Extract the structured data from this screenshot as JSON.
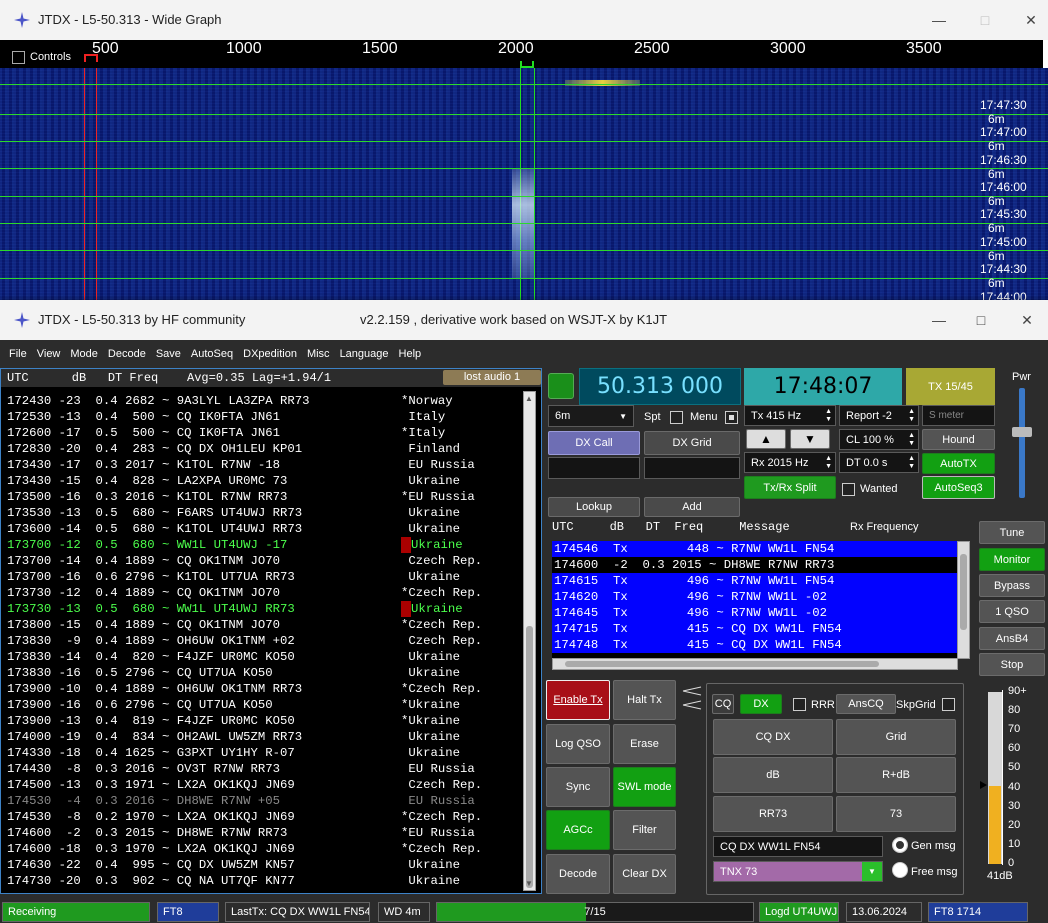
{
  "wide_graph": {
    "title": "JTDX - L5-50.313 - Wide Graph",
    "controls_label": "Controls",
    "ruler_ticks": [
      "500",
      "1000",
      "1500",
      "2000",
      "2500",
      "3000",
      "3500"
    ],
    "time_labels": [
      "17:47:30",
      "17:47:00",
      "17:46:30",
      "17:46:00",
      "17:45:30",
      "17:45:00",
      "17:44:30",
      "17:44:00"
    ],
    "band_suffix": "6m"
  },
  "main": {
    "title": "JTDX - L5-50.313  by HF community",
    "subtitle": "v2.2.159 , derivative work based on WSJT-X by K1JT",
    "menu": [
      "File",
      "View",
      "Mode",
      "Decode",
      "Save",
      "AutoSeq",
      "DXpedition",
      "Misc",
      "Language",
      "Help"
    ],
    "decode_header": "UTC      dB   DT Freq    Avg=0.35 Lag=+1.94/1",
    "lost_audio": "lost audio 1",
    "decodes": [
      {
        "msg": "172430 -23  0.4 2682 ~ 9A3LYL LA3ZPA RR73",
        "country": "*Norway",
        "color": "#ffffff",
        "mark": false
      },
      {
        "msg": "172530 -13  0.4  500 ~ CQ IK0FTA JN61",
        "country": " Italy",
        "color": "#ffffff",
        "mark": false
      },
      {
        "msg": "172600 -17  0.5  500 ~ CQ IK0FTA JN61",
        "country": "*Italy",
        "color": "#ffffff",
        "mark": false
      },
      {
        "msg": "172830 -20  0.4  283 ~ CQ DX OH1LEU KP01",
        "country": " Finland",
        "color": "#ffffff",
        "mark": false
      },
      {
        "msg": "173430 -17  0.3 2017 ~ K1TOL R7NW -18",
        "country": " EU Russia",
        "color": "#ffffff",
        "mark": false
      },
      {
        "msg": "173430 -15  0.4  828 ~ LA2XPA UR0MC 73",
        "country": " Ukraine",
        "color": "#ffffff",
        "mark": false
      },
      {
        "msg": "173500 -16  0.3 2016 ~ K1TOL R7NW RR73",
        "country": "*EU Russia",
        "color": "#ffffff",
        "mark": false
      },
      {
        "msg": "173530 -13  0.5  680 ~ F6ARS UT4UWJ RR73",
        "country": " Ukraine",
        "color": "#ffffff",
        "mark": false
      },
      {
        "msg": "173600 -14  0.5  680 ~ K1TOL UT4UWJ RR73",
        "country": " Ukraine",
        "color": "#ffffff",
        "mark": false
      },
      {
        "msg": "173700 -12  0.5  680 ~ WW1L UT4UWJ -17",
        "country": "Ukraine",
        "color": "#4cff4c",
        "mark": true
      },
      {
        "msg": "173700 -14  0.4 1889 ~ CQ OK1TNM JO70",
        "country": " Czech Rep.",
        "color": "#ffffff",
        "mark": false
      },
      {
        "msg": "173700 -16  0.6 2796 ~ K1TOL UT7UA RR73",
        "country": " Ukraine",
        "color": "#ffffff",
        "mark": false
      },
      {
        "msg": "173730 -12  0.4 1889 ~ CQ OK1TNM JO70",
        "country": "*Czech Rep.",
        "color": "#ffffff",
        "mark": false
      },
      {
        "msg": "173730 -13  0.5  680 ~ WW1L UT4UWJ RR73",
        "country": "Ukraine",
        "color": "#4cff4c",
        "mark": true
      },
      {
        "msg": "173800 -15  0.4 1889 ~ CQ OK1TNM JO70",
        "country": "*Czech Rep.",
        "color": "#ffffff",
        "mark": false
      },
      {
        "msg": "173830  -9  0.4 1889 ~ OH6UW OK1TNM +02",
        "country": " Czech Rep.",
        "color": "#ffffff",
        "mark": false
      },
      {
        "msg": "173830 -14  0.4  820 ~ F4JZF UR0MC KO50",
        "country": " Ukraine",
        "color": "#ffffff",
        "mark": false
      },
      {
        "msg": "173830 -16  0.5 2796 ~ CQ UT7UA KO50",
        "country": " Ukraine",
        "color": "#ffffff",
        "mark": false
      },
      {
        "msg": "173900 -10  0.4 1889 ~ OH6UW OK1TNM RR73",
        "country": "*Czech Rep.",
        "color": "#ffffff",
        "mark": false
      },
      {
        "msg": "173900 -16  0.6 2796 ~ CQ UT7UA KO50",
        "country": "*Ukraine",
        "color": "#ffffff",
        "mark": false
      },
      {
        "msg": "173900 -13  0.4  819 ~ F4JZF UR0MC KO50",
        "country": "*Ukraine",
        "color": "#ffffff",
        "mark": false
      },
      {
        "msg": "174000 -19  0.4  834 ~ OH2AWL UW5ZM RR73",
        "country": " Ukraine",
        "color": "#ffffff",
        "mark": false
      },
      {
        "msg": "174330 -18  0.4 1625 ~ G3PXT UY1HY R-07",
        "country": " Ukraine",
        "color": "#ffffff",
        "mark": false
      },
      {
        "msg": "174430  -8  0.3 2016 ~ OV3T R7NW RR73",
        "country": " EU Russia",
        "color": "#ffffff",
        "mark": false
      },
      {
        "msg": "174500 -13  0.3 1971 ~ LX2A OK1KQJ JN69",
        "country": " Czech Rep.",
        "color": "#ffffff",
        "mark": false
      },
      {
        "msg": "174530  -4  0.3 2016 ~ DH8WE R7NW +05",
        "country": " EU Russia",
        "color": "#8a8a8a",
        "mark": false
      },
      {
        "msg": "174530  -8  0.2 1970 ~ LX2A OK1KQJ JN69",
        "country": "*Czech Rep.",
        "color": "#ffffff",
        "mark": false
      },
      {
        "msg": "174600  -2  0.3 2015 ~ DH8WE R7NW RR73",
        "country": "*EU Russia",
        "color": "#ffffff",
        "mark": false
      },
      {
        "msg": "174600 -18  0.3 1970 ~ LX2A OK1KQJ JN69",
        "country": "*Czech Rep.",
        "color": "#ffffff",
        "mark": false
      },
      {
        "msg": "174630 -22  0.4  995 ~ CQ DX UW5ZM KN57",
        "country": " Ukraine",
        "color": "#ffffff",
        "mark": false
      },
      {
        "msg": "174730 -20  0.3  902 ~ CQ NA UT7QF KN77",
        "country": " Ukraine",
        "color": "#ffffff",
        "mark": false
      }
    ],
    "freq": "50.313 000",
    "clock": "17:48:07",
    "tx_period": "TX 15/45",
    "pwr_label": "Pwr",
    "band": "6m",
    "spt_label": "Spt",
    "menu_label": "Menu",
    "dx_call_btn": "DX Call",
    "dx_grid_btn": "DX Grid",
    "tx_hz": "Tx  415  Hz",
    "rx_hz": "Rx  2015  Hz",
    "report": "Report -2",
    "cl": "CL  100 %",
    "dt": "DT 0.0 s",
    "s_meter": "S meter",
    "hound": "Hound",
    "autotx": "AutoTX",
    "autoseq3": "AutoSeq3",
    "wanted": "Wanted",
    "txrx_split": "Tx/Rx Split",
    "lookup": "Lookup",
    "add": "Add",
    "rx_header_left": "UTC     dB   DT  Freq     Message",
    "rx_header_right": "Rx Frequency",
    "tx_rows": [
      {
        "text": "174546  Tx        448 ~ R7NW WW1L FN54",
        "sel": true
      },
      {
        "text": "174600  -2  0.3 2015 ~ DH8WE R7NW RR73",
        "sel": false
      },
      {
        "text": "174615  Tx        496 ~ R7NW WW1L FN54",
        "sel": true
      },
      {
        "text": "174620  Tx        496 ~ R7NW WW1L -02",
        "sel": true
      },
      {
        "text": "174645  Tx        496 ~ R7NW WW1L -02",
        "sel": true
      },
      {
        "text": "174715  Tx        415 ~ CQ DX WW1L FN54",
        "sel": true
      },
      {
        "text": "174748  Tx        415 ~ CQ DX WW1L FN54",
        "sel": true
      }
    ],
    "side_buttons": [
      "Tune",
      "Monitor",
      "Bypass",
      "1 QSO",
      "AnsB4",
      "Stop"
    ],
    "enable_tx": "Enable Tx",
    "halt_tx": "Halt Tx",
    "log_qso": "Log QSO",
    "erase": "Erase",
    "sync": "Sync",
    "swl_mode": "SWL mode",
    "agcc": "AGCc",
    "filter": "Filter",
    "decode": "Decode",
    "clear_dx": "Clear DX",
    "cq_label": "CQ",
    "dx_label": "DX",
    "rrr_label": "RRR",
    "anscq": "AnsCQ",
    "skpgrid": "SkpGrid",
    "macro_btns": [
      "CQ DX",
      "Grid",
      "dB",
      "R+dB",
      "RR73",
      "73"
    ],
    "gen_msg_value": "CQ DX WW1L FN54",
    "free_msg_value": "TNX 73",
    "gen_msg_label": "Gen msg",
    "free_msg_label": "Free msg",
    "meter_ticks": [
      "90+",
      "80",
      "70",
      "60",
      "50",
      "40",
      "30",
      "20",
      "10",
      "0"
    ],
    "meter_db": "41dB",
    "meter_level_db": 41
  },
  "status": {
    "receiving": "Receiving",
    "mode": "FT8",
    "last_tx": "LastTx: CQ DX WW1L FN54",
    "wd": "WD 4m",
    "progress": "7/15",
    "progress_value": 0.47,
    "logd": "Logd UT4UWJ",
    "date": "13.06.2024",
    "mode_freq": "FT8  1714"
  },
  "colors": {
    "accent_green": "#12a012",
    "tx_blue": "#0202ff",
    "decode_green": "#4cff4c",
    "freq_bg": "#004a5e",
    "clock_bg": "#2ea8a8",
    "txperiod_bg": "#a8a834"
  }
}
